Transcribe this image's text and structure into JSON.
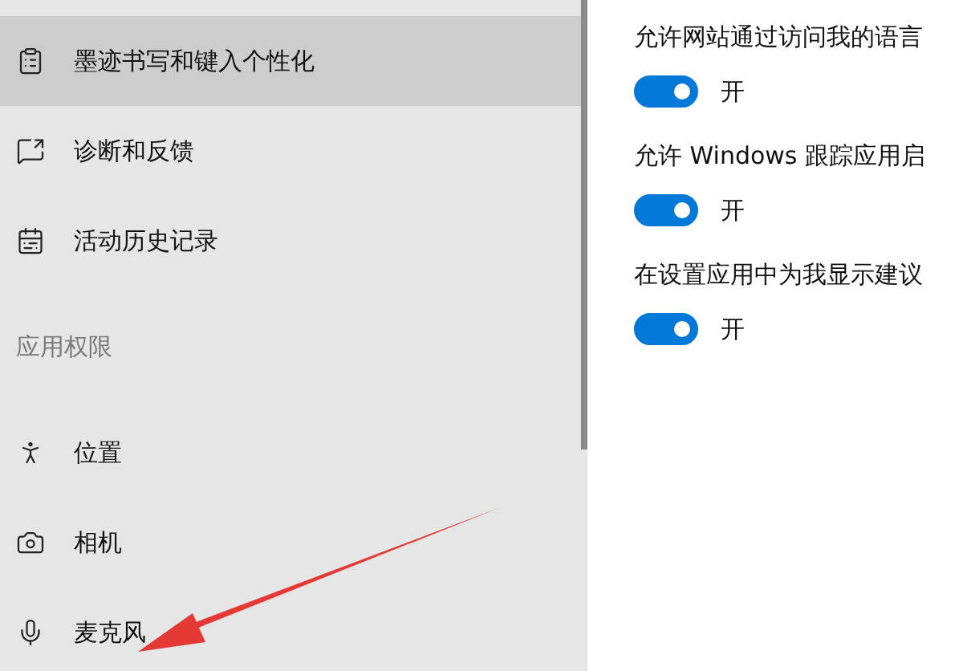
{
  "sidebar": {
    "items": [
      {
        "label": "墨迹书写和键入个性化",
        "selected": true
      },
      {
        "label": "诊断和反馈",
        "selected": false
      },
      {
        "label": "活动历史记录",
        "selected": false
      }
    ],
    "section_header": "应用权限",
    "permission_items": [
      {
        "label": "位置",
        "selected": false
      },
      {
        "label": "相机",
        "selected": false
      },
      {
        "label": "麦克风",
        "selected": false
      }
    ]
  },
  "settings": [
    {
      "label": "允许网站通过访问我的语言",
      "on": true,
      "state_text": "开"
    },
    {
      "label": "允许 Windows 跟踪应用启",
      "on": true,
      "state_text": "开"
    },
    {
      "label": "在设置应用中为我显示建议",
      "on": true,
      "state_text": "开"
    }
  ]
}
